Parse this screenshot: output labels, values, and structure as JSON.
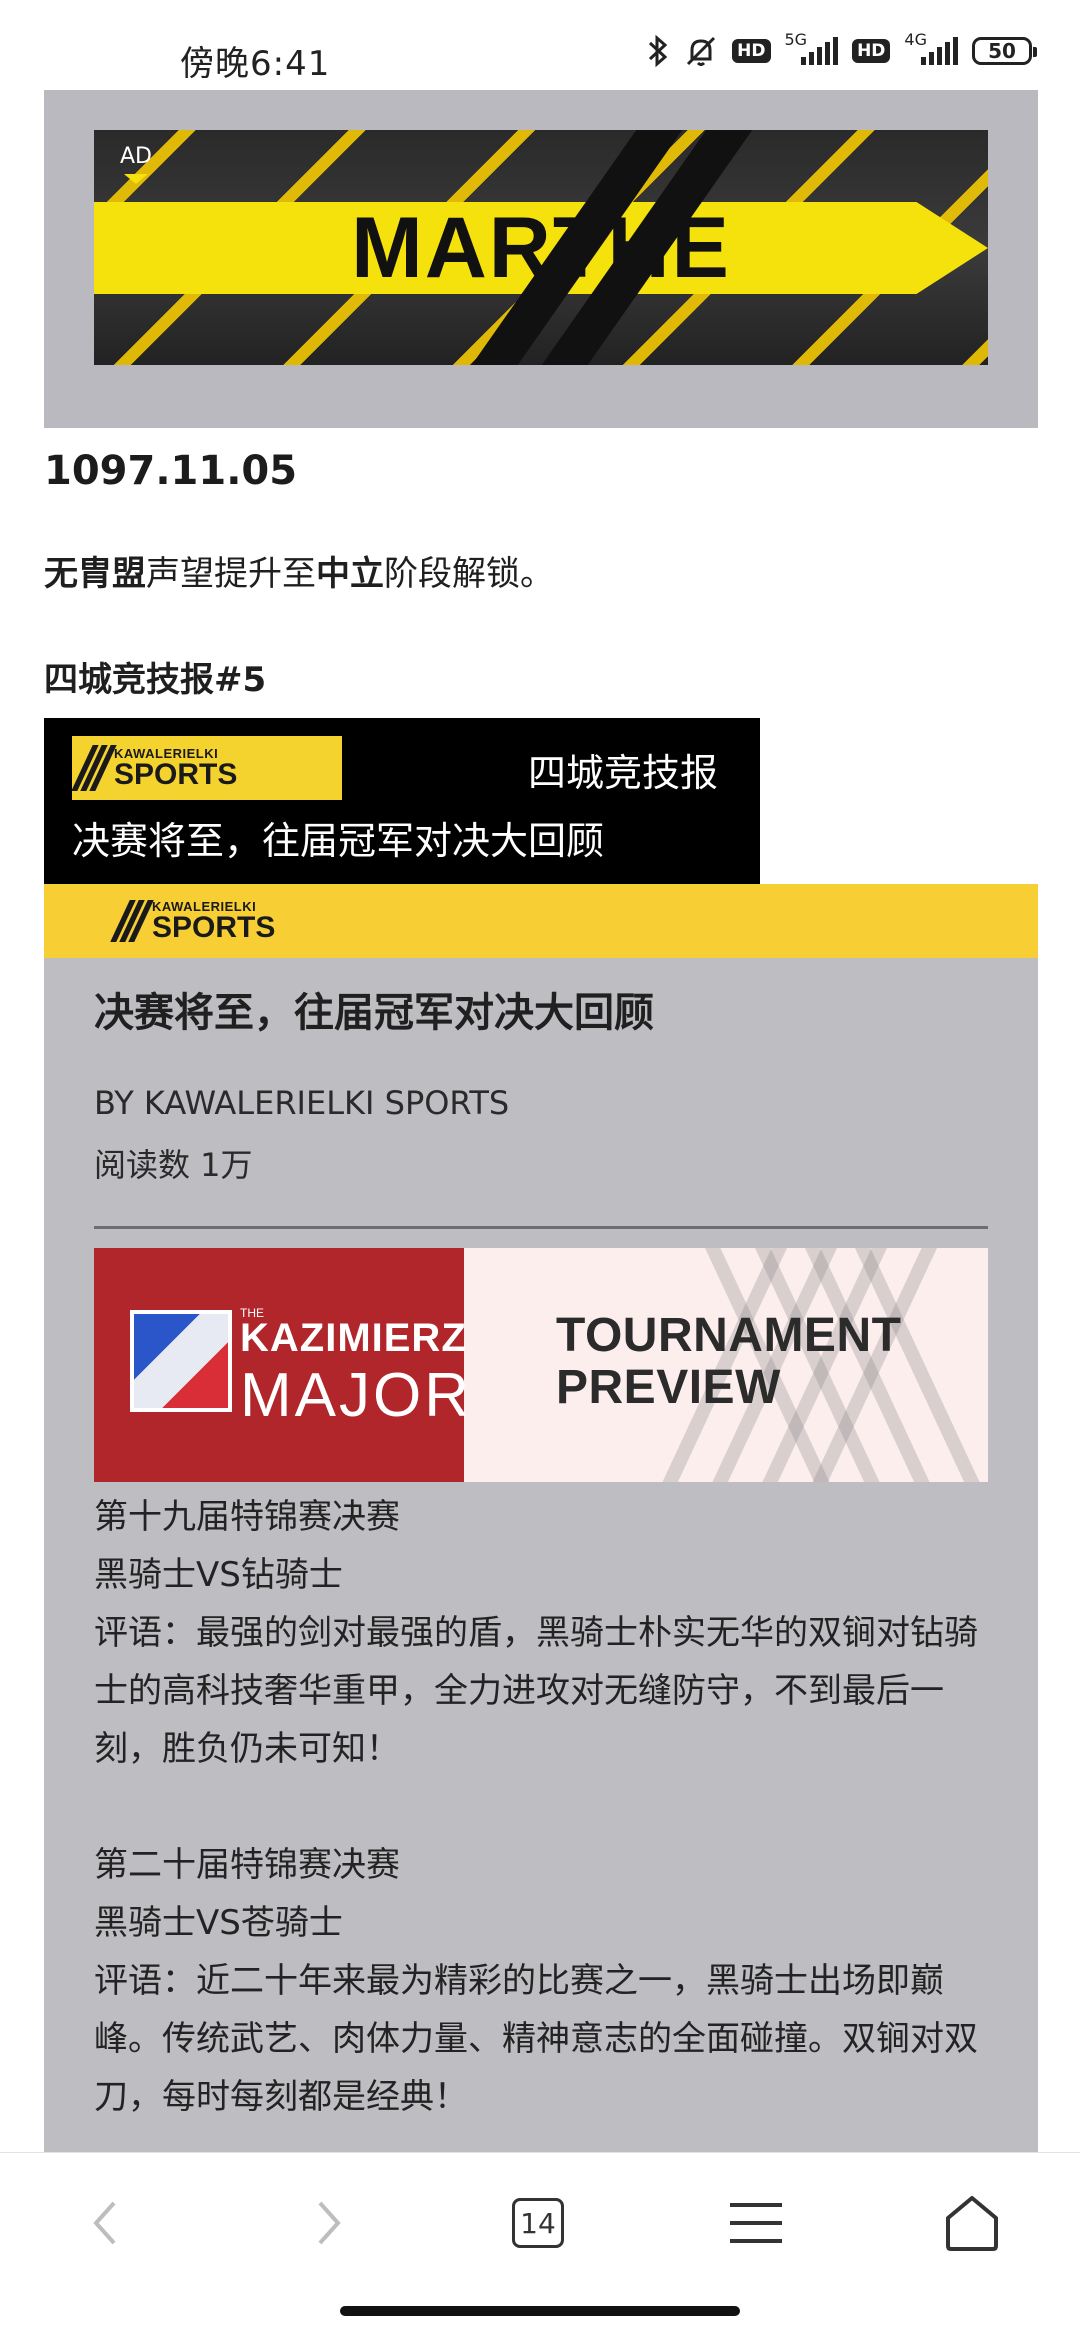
{
  "status_bar": {
    "time": "傍晚6:41",
    "net1": "5G",
    "net2": "4G",
    "hd": "HD",
    "battery": "50",
    "icons": [
      "bluetooth-icon",
      "mute-bell-icon",
      "signal-icon",
      "battery-icon"
    ]
  },
  "ad": {
    "label": "AD",
    "title": "MARTHE"
  },
  "post": {
    "date": "1097.11.05",
    "event_parts": [
      "无胄盟",
      "声望提升至",
      "中立",
      "阶段解锁。"
    ],
    "report_heading": "四城竞技报#5"
  },
  "news_card": {
    "logo_top": "KAWALERIELKI",
    "logo_main": "SPORTS",
    "header_right": "四城竞技报",
    "header_subtitle": "决赛将至，往届冠军对决大回顾"
  },
  "article": {
    "logo_top": "KAWALERIELKI",
    "logo_main": "SPORTS",
    "title": "决赛将至，往届冠军对决大回顾",
    "byline": "BY KAWALERIELKI SPORTS",
    "read_count": "阅读数 1万",
    "preview": {
      "kz_small": "THE",
      "kz_line1": "KAZIMIERZ",
      "kz_line2": "MAJOR",
      "tp_line1": "TOURNAMENT",
      "tp_line2": "PREVIEW"
    },
    "match1_title": "第十九届特锦赛决赛",
    "match1_vs": "黑骑士VS钻骑士",
    "match1_comment": "评语：最强的剑对最强的盾，黑骑士朴实无华的双锏对钻骑士的高科技奢华重甲，全力进攻对无缝防守，不到最后一刻，胜负仍未可知！",
    "match2_title": "第二十届特锦赛决赛",
    "match2_vs": "黑骑士VS苍骑士",
    "match2_comment": "评语：近二十年来最为精彩的比赛之一，黑骑士出场即巅峰。传统武艺、肉体力量、精神意志的全面碰撞。双锏对双刀，每时每刻都是经典！"
  },
  "bottom_nav": {
    "tab_count": "14",
    "icons": [
      "back-arrow-icon",
      "forward-arrow-icon",
      "tabs-icon",
      "menu-icon",
      "home-icon"
    ]
  }
}
